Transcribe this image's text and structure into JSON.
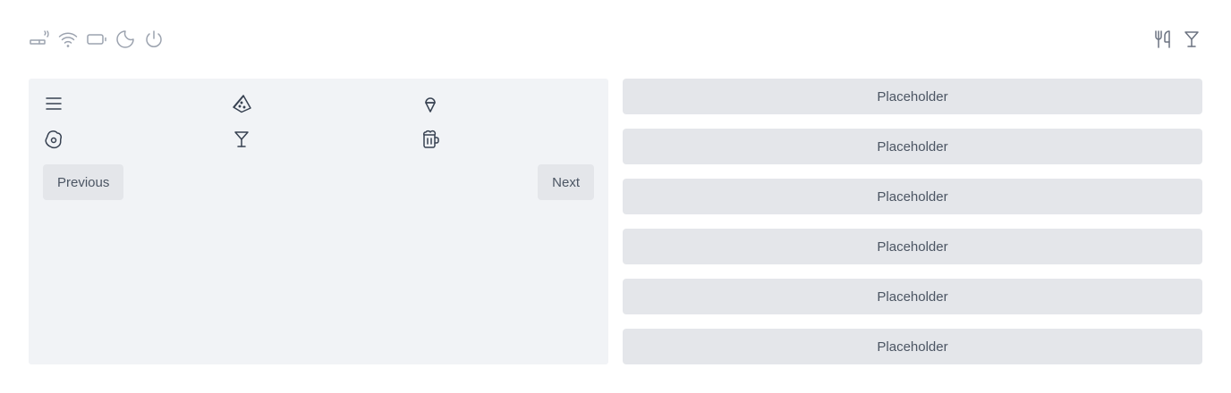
{
  "status_icons": [
    "smoking-icon",
    "wifi-icon",
    "battery-icon",
    "moon-icon",
    "power-icon"
  ],
  "food_icons": [
    "utensils-icon",
    "cocktail-icon"
  ],
  "grid": {
    "icons": [
      "menu-icon",
      "pizza-icon",
      "ice-cream-icon",
      "egg-icon",
      "cocktail-icon",
      "beer-icon"
    ]
  },
  "pager": {
    "previous_label": "Previous",
    "next_label": "Next"
  },
  "list": {
    "items": [
      "Placeholder",
      "Placeholder",
      "Placeholder",
      "Placeholder",
      "Placeholder",
      "Placeholder"
    ]
  }
}
